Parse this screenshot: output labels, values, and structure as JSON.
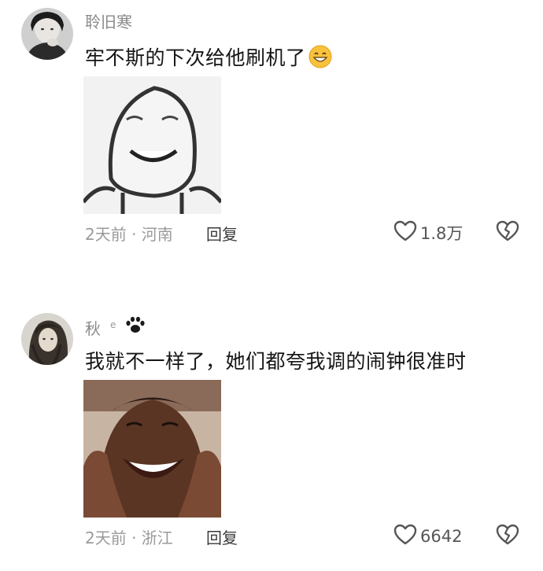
{
  "comments": [
    {
      "username": "聆旧寒",
      "text": "牢不斯的下次给他刷机了",
      "emoji": "grinning-face-emoji",
      "time_location": "2天前 · 河南",
      "reply_label": "回复",
      "like_count": "1.8万"
    },
    {
      "username": "秋",
      "badge": "e",
      "text": "我就不一样了，她们都夸我调的闹钟很准时",
      "time_location": "2天前 · 浙江",
      "reply_label": "回复",
      "like_count": "6642"
    }
  ],
  "colors": {
    "username": "#8a8a8a",
    "meta": "#9a9a9a",
    "text": "#151515",
    "icon": "#555555"
  }
}
